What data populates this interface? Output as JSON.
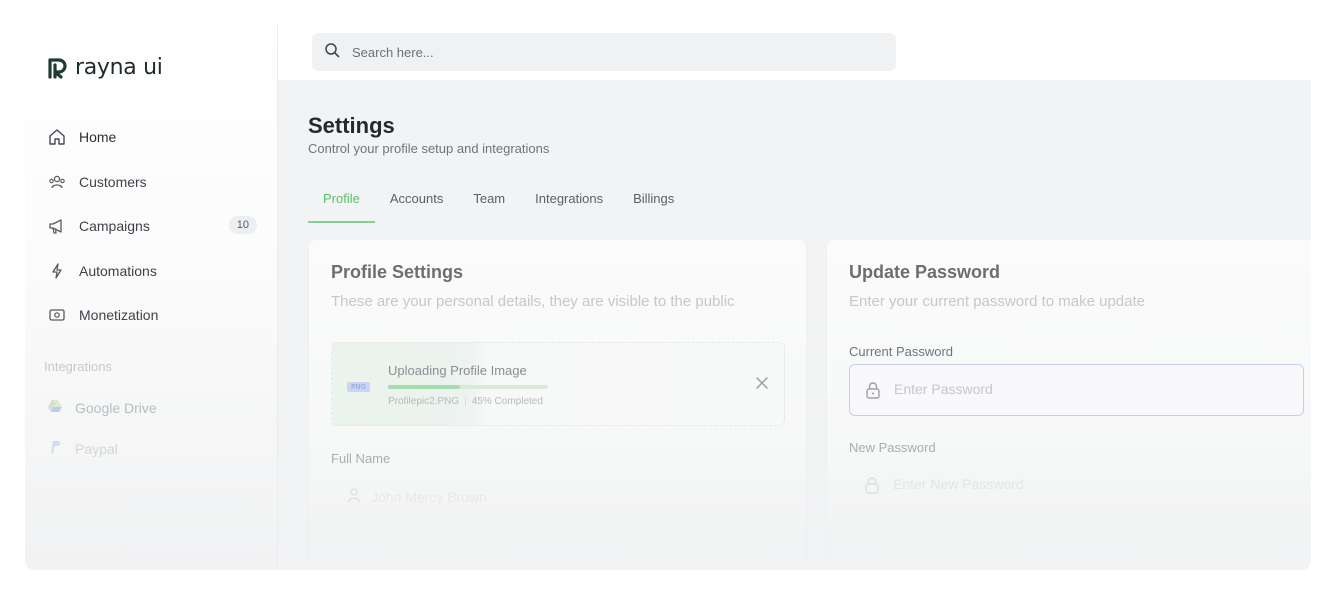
{
  "app": {
    "logo_text": "rayna ui",
    "logo_mark": "R"
  },
  "search": {
    "placeholder": "Search here..."
  },
  "sidebar": {
    "items": [
      {
        "label": "Home",
        "icon": "home-icon"
      },
      {
        "label": "Customers",
        "icon": "users-icon"
      },
      {
        "label": "Campaigns",
        "icon": "megaphone-icon",
        "badge": "10"
      },
      {
        "label": "Automations",
        "icon": "lightning-icon"
      },
      {
        "label": "Monetization",
        "icon": "money-icon"
      }
    ],
    "integrations_label": "Integrations",
    "integrations": [
      {
        "label": "Google Drive",
        "icon": "google-drive-icon"
      },
      {
        "label": "Paypal",
        "icon": "paypal-icon"
      }
    ]
  },
  "page": {
    "title": "Settings",
    "subtitle": "Control your profile setup and integrations",
    "tabs": [
      "Profile",
      "Accounts",
      "Team",
      "Integrations",
      "Billings"
    ],
    "active_tab": "Profile"
  },
  "profile_card": {
    "title": "Profile Settings",
    "subtitle": "These are your personal details, they are visible to the public",
    "upload": {
      "file_type": "PNG",
      "title": "Uploading Profile Image",
      "file_name": "Profilepic2.PNG",
      "status": "45% Completed",
      "progress": 0.45
    },
    "full_name_label": "Full Name",
    "full_name_value": "John Mercy Brown"
  },
  "password_card": {
    "title": "Update Password",
    "subtitle": "Enter your current password to make update",
    "current_label": "Current Password",
    "current_placeholder": "Enter Password",
    "new_label": "New Password",
    "new_placeholder": "Enter New Password"
  },
  "colors": {
    "accent": "#5fbf6b",
    "tab_underline": "#86d18f",
    "logo": "#1f3b34",
    "input_focus_border": "#c9cdf0"
  }
}
